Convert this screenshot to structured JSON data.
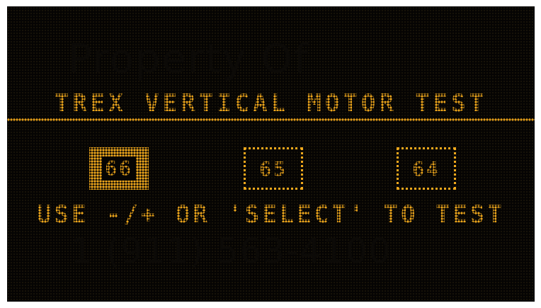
{
  "screen": {
    "title": "TREX VERTICAL MOTOR TEST",
    "instruction": "USE -/+ OR 'SELECT' TO TEST",
    "accent_color": "#f0a81c",
    "background_color": "#050403"
  },
  "watermark": {
    "top": "Property Of",
    "bottom": "1 (911) 563-4100"
  },
  "motors": [
    {
      "number": "66",
      "selected": true
    },
    {
      "number": "65",
      "selected": false
    },
    {
      "number": "64",
      "selected": false
    }
  ]
}
